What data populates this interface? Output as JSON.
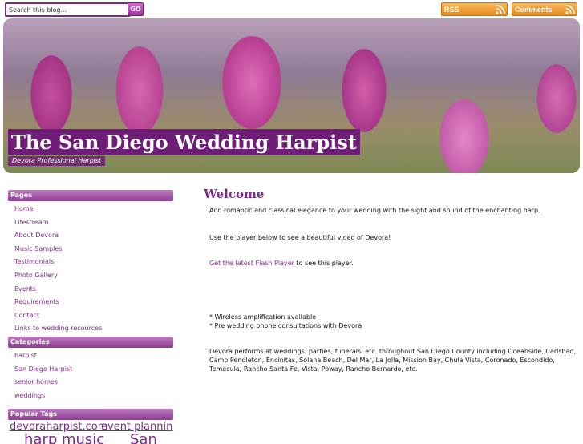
{
  "search": {
    "placeholder": "Search this blog...",
    "value": "Search this blog...",
    "go_label": "GO"
  },
  "feeds": {
    "rss_label": "RSS",
    "comments_label": "Comments"
  },
  "header": {
    "title": "The San Diego Wedding Harpist",
    "description": "Devora Professional Harpist"
  },
  "sidebar": {
    "pages_title": "Pages",
    "pages": [
      "Home",
      "Lifestream",
      "About Devora",
      "Music Samples",
      "Testimonials",
      "Photo Gallery",
      "Events",
      "Requirements",
      "Contact",
      "Links to wedding recources"
    ],
    "categories_title": "Categories",
    "categories": [
      "harpist",
      "San Diego Harpist",
      "senior homes",
      "weddings"
    ],
    "tags_title": "Popular Tags",
    "tags": [
      "devoraharpist.com",
      "event planning",
      "harp music",
      "San"
    ]
  },
  "main": {
    "heading": "Welcome",
    "intro": "Add romantic and classical elegance to your wedding with the sight and sound of the enchanting harp.",
    "player_text": "Use the player below to see a beautiful video of Devora!",
    "flash_link": "Get the latest Flash Player",
    "flash_suffix": " to see this player.",
    "bullet1": "* Wireless amplification available",
    "bullet2": "* Pre wedding phone consultations with Devora",
    "perform1": "Devora performs at weddings, parties, funerals, etc.  throughout San Diego County including Oceanside, Carlsbad,",
    "perform2": "Camp Pendleton, Encinitas, Solana Beach, Del Mar, La Jolla, Mission Bay, Chula Vista, Coronado, Escondido,",
    "perform3": "Temecula, Rancho Santa Fe, Vista,  Poway, Rancho Bernardo,  etc."
  },
  "colors": {
    "accent": "#7b2c85",
    "title_bg": "#6e1e76",
    "feed_orange": "#f0a040"
  }
}
